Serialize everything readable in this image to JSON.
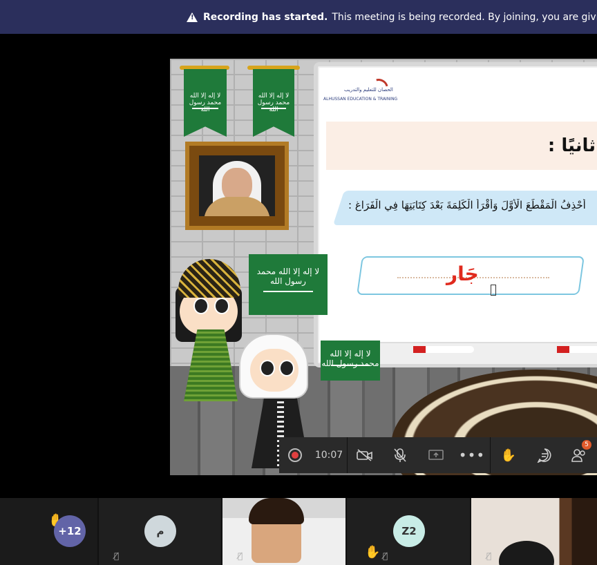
{
  "recording_banner": {
    "bold": "Recording has started.",
    "text": "This meeting is being recorded. By joining, you are giving consent fo"
  },
  "slide": {
    "logo_ar": "الحصان للتعليم والتدريب",
    "logo_en": "ALHUSSAN EDUCATION & TRAINING",
    "flag_text": "لا إله إلا الله محمد رسول الله",
    "title": "ثانيًا :",
    "instruction": "أَحْذِفُ الْمَقْطَعَ الْأَوَّلَ وَأَقْرَأُ الْكَلِمَةَ بَعْدَ كِتَابَتِهَا فِي الْفَرَاغِ :",
    "answer": "جَار"
  },
  "controls": {
    "timer": "10:07",
    "participants_badge": "5",
    "icons": [
      "record-icon",
      "camera-off-icon",
      "mic-off-icon",
      "share-screen-icon",
      "more-icon",
      "raise-hand-icon",
      "chat-icon",
      "participants-icon"
    ]
  },
  "participants": {
    "overflow": "+12",
    "tile2_initial": "م",
    "tile4_initial": "Z2"
  },
  "colors": {
    "banner_bg": "#2b2f5c",
    "answer_red": "#e02a1e",
    "overflow_avatar": "#6264a7",
    "raise_hand": "#f2b91f"
  }
}
